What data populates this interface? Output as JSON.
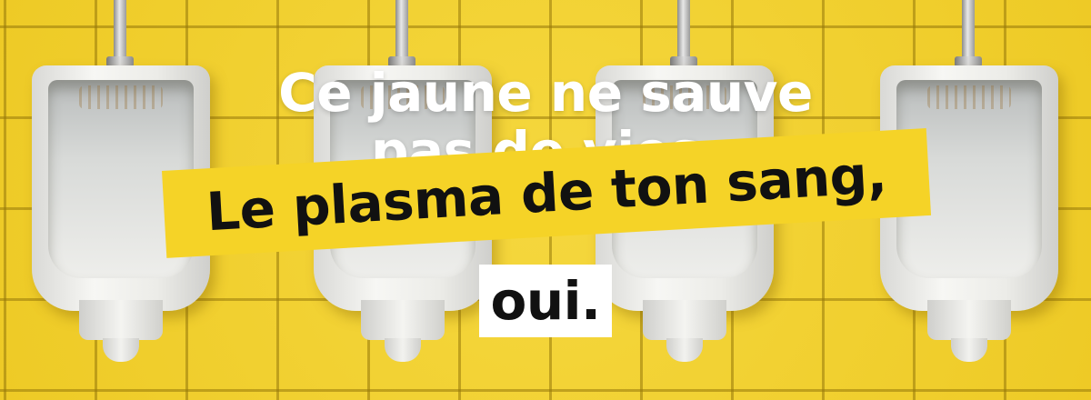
{
  "headline": {
    "line1": "Ce jaune ne sauve",
    "line2": "pas de vies."
  },
  "band": {
    "text": "Le plasma de ton sang,"
  },
  "oui": {
    "text": "oui."
  },
  "colors": {
    "tile_yellow": "#f2cf2a",
    "band_yellow": "#f5d327",
    "text_white": "#ffffff",
    "text_black": "#111111"
  },
  "photo": {
    "subject": "urinals"
  }
}
